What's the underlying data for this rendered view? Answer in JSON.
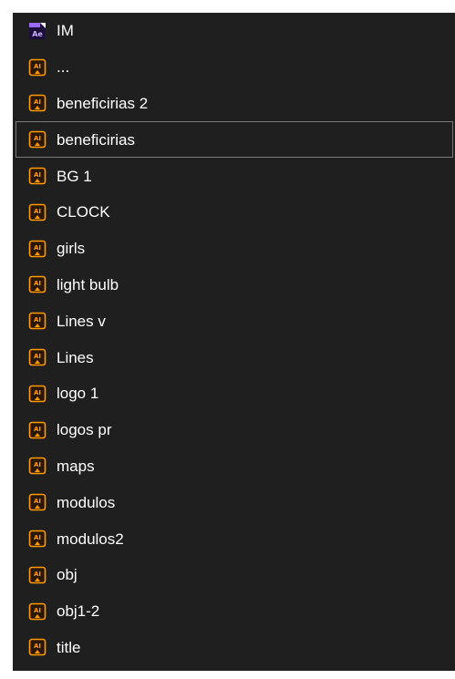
{
  "colors": {
    "panel_bg": "#1f1f1f",
    "ai_icon_bg": "#2a1700",
    "ai_icon_border": "#ff9a00",
    "ae_icon_bg": "#1d0e3a",
    "ae_icon_accent": "#9b6bff",
    "selection_border": "#7a7a7a",
    "text": "#ffffff"
  },
  "files": [
    {
      "label": "IM",
      "icon": "after-effects-file-icon",
      "icon_text": "Ae",
      "selected": false
    },
    {
      "label": "...",
      "icon": "illustrator-file-icon",
      "icon_text": "AI",
      "selected": false
    },
    {
      "label": "beneficirias 2",
      "icon": "illustrator-file-icon",
      "icon_text": "AI",
      "selected": false
    },
    {
      "label": "beneficirias",
      "icon": "illustrator-file-icon",
      "icon_text": "AI",
      "selected": true
    },
    {
      "label": "BG 1",
      "icon": "illustrator-file-icon",
      "icon_text": "AI",
      "selected": false
    },
    {
      "label": "CLOCK",
      "icon": "illustrator-file-icon",
      "icon_text": "AI",
      "selected": false
    },
    {
      "label": "girls",
      "icon": "illustrator-file-icon",
      "icon_text": "AI",
      "selected": false
    },
    {
      "label": "light bulb",
      "icon": "illustrator-file-icon",
      "icon_text": "AI",
      "selected": false
    },
    {
      "label": "Lines v",
      "icon": "illustrator-file-icon",
      "icon_text": "AI",
      "selected": false
    },
    {
      "label": "Lines",
      "icon": "illustrator-file-icon",
      "icon_text": "AI",
      "selected": false
    },
    {
      "label": "logo 1",
      "icon": "illustrator-file-icon",
      "icon_text": "AI",
      "selected": false
    },
    {
      "label": "logos pr",
      "icon": "illustrator-file-icon",
      "icon_text": "AI",
      "selected": false
    },
    {
      "label": "maps",
      "icon": "illustrator-file-icon",
      "icon_text": "AI",
      "selected": false
    },
    {
      "label": "modulos",
      "icon": "illustrator-file-icon",
      "icon_text": "AI",
      "selected": false
    },
    {
      "label": "modulos2",
      "icon": "illustrator-file-icon",
      "icon_text": "AI",
      "selected": false
    },
    {
      "label": "obj",
      "icon": "illustrator-file-icon",
      "icon_text": "AI",
      "selected": false
    },
    {
      "label": "obj1-2",
      "icon": "illustrator-file-icon",
      "icon_text": "AI",
      "selected": false
    },
    {
      "label": "title",
      "icon": "illustrator-file-icon",
      "icon_text": "AI",
      "selected": false
    }
  ]
}
